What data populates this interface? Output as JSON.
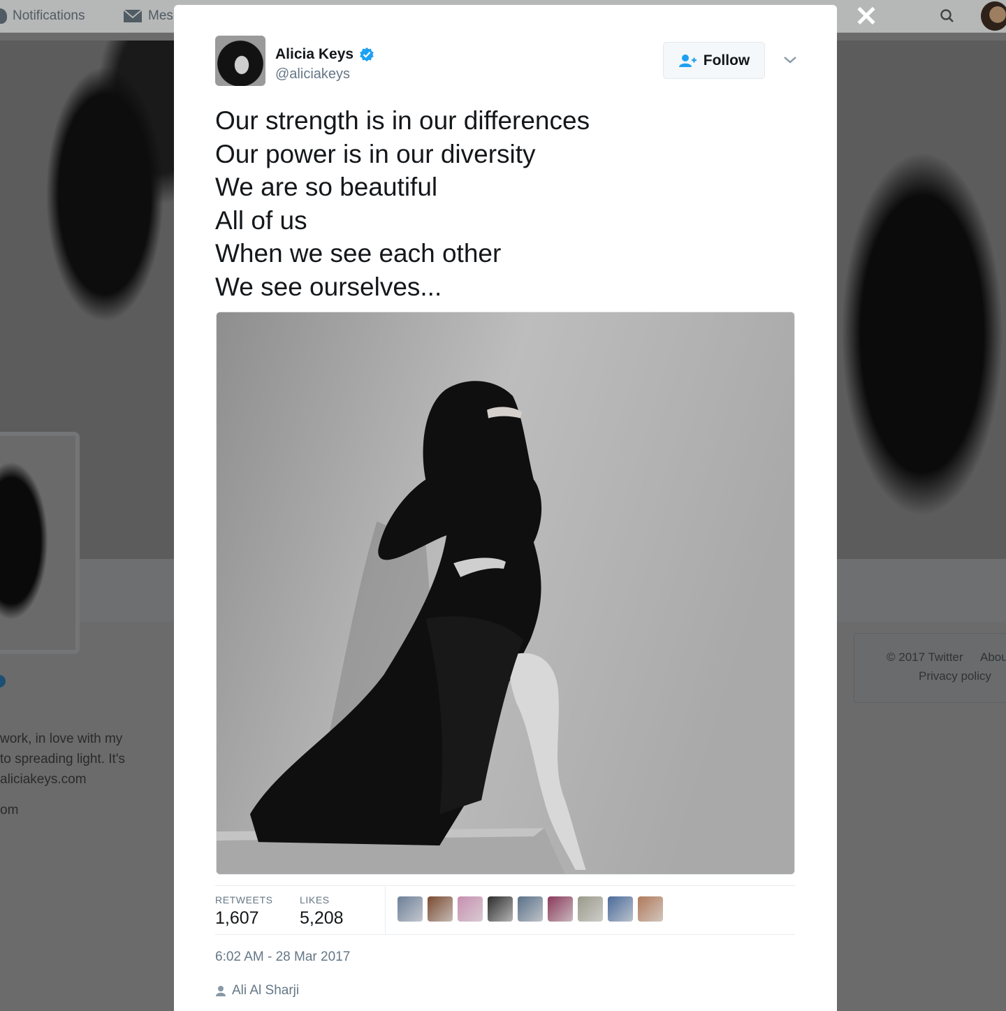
{
  "background": {
    "nav": {
      "notifications_label": "Notifications",
      "messages_label": "Mes"
    },
    "bio_lines": [
      "work, in love with my",
      "to spreading light. It's",
      "aliciakeys.com",
      "om"
    ],
    "footer": {
      "copyright": "© 2017 Twitter",
      "about": "Abou",
      "privacy": "Privacy policy"
    }
  },
  "tweet": {
    "author": {
      "name": "Alicia Keys",
      "handle": "@aliciakeys"
    },
    "follow_label": "Follow",
    "text_lines": [
      "Our strength is in our differences",
      "Our power is in our diversity",
      "We are so beautiful",
      "All of us",
      "When we see each other",
      "We see ourselves..."
    ],
    "stats": {
      "retweets_label": "RETWEETS",
      "retweets": "1,607",
      "likes_label": "LIKES",
      "likes": "5,208"
    },
    "liker_colors": [
      "#6d7f99",
      "#7a4a30",
      "#c88fb0",
      "#2d2d2d",
      "#5a7088",
      "#8a3a5a",
      "#9a9a8a",
      "#4a6a9a",
      "#b07a5a"
    ],
    "timestamp": "6:02 AM - 28 Mar 2017",
    "source_user": "Ali Al Sharji"
  },
  "colors": {
    "verified": "#1da1f2",
    "accent": "#1da1f2"
  }
}
